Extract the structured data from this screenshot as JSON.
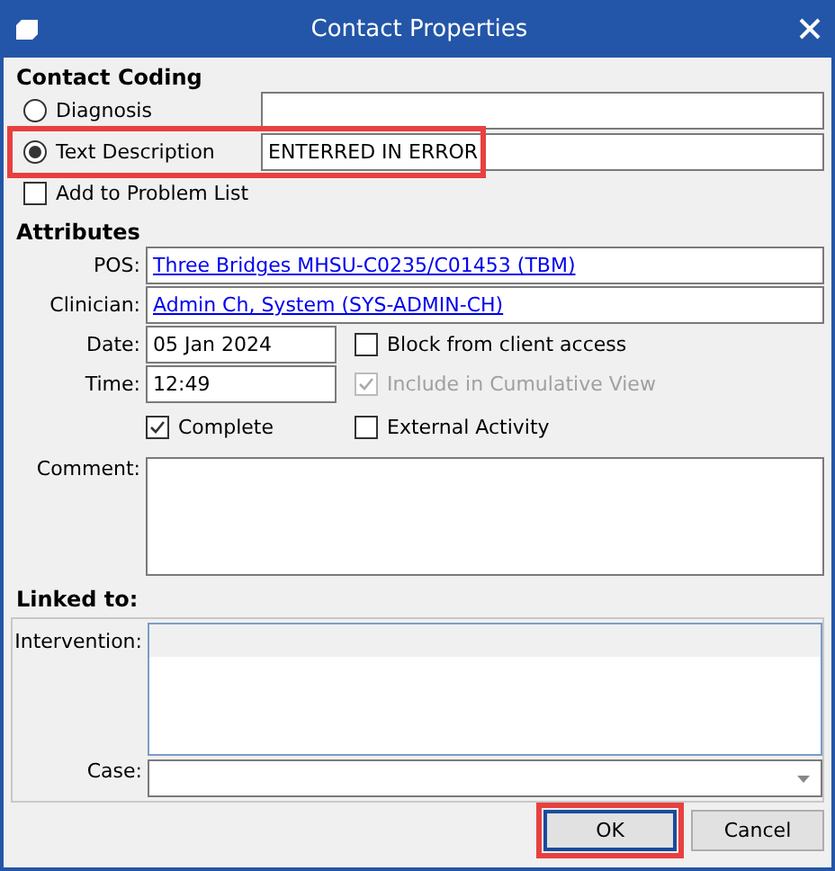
{
  "window": {
    "title": "Contact Properties"
  },
  "contact_coding": {
    "heading": "Contact Coding",
    "options": [
      {
        "label": "Diagnosis",
        "selected": false,
        "highlighted": false
      },
      {
        "label": "Text Description",
        "selected": true,
        "value": "ENTERRED IN ERROR",
        "highlighted": true
      }
    ],
    "add_to_problem_list": {
      "label": "Add to Problem List",
      "checked": false
    }
  },
  "attributes": {
    "heading": "Attributes",
    "links": [
      {
        "label": "POS:",
        "value": "Three Bridges MHSU-C0235/C01453 (TBM)"
      },
      {
        "label": "Clinician:",
        "value": "Admin Ch, System (SYS-ADMIN-CH)"
      }
    ],
    "date": {
      "label": "Date:",
      "value": "05 Jan 2024"
    },
    "time": {
      "label": "Time:",
      "value": "12:49"
    },
    "checkboxes": [
      {
        "label": "Block from client access",
        "checked": false,
        "disabled": false
      },
      {
        "label": "Include in Cumulative View",
        "checked": true,
        "disabled": true
      },
      {
        "label": "Complete",
        "checked": true,
        "disabled": false
      },
      {
        "label": "External Activity",
        "checked": false,
        "disabled": false
      }
    ],
    "comment": {
      "label": "Comment:"
    }
  },
  "linked_to": {
    "heading": "Linked to:",
    "intervention": {
      "label": "Intervention:"
    },
    "case": {
      "label": "Case:"
    }
  },
  "buttons": [
    {
      "label": "OK",
      "default": true,
      "highlighted": true
    },
    {
      "label": "Cancel",
      "default": false,
      "highlighted": false
    }
  ]
}
